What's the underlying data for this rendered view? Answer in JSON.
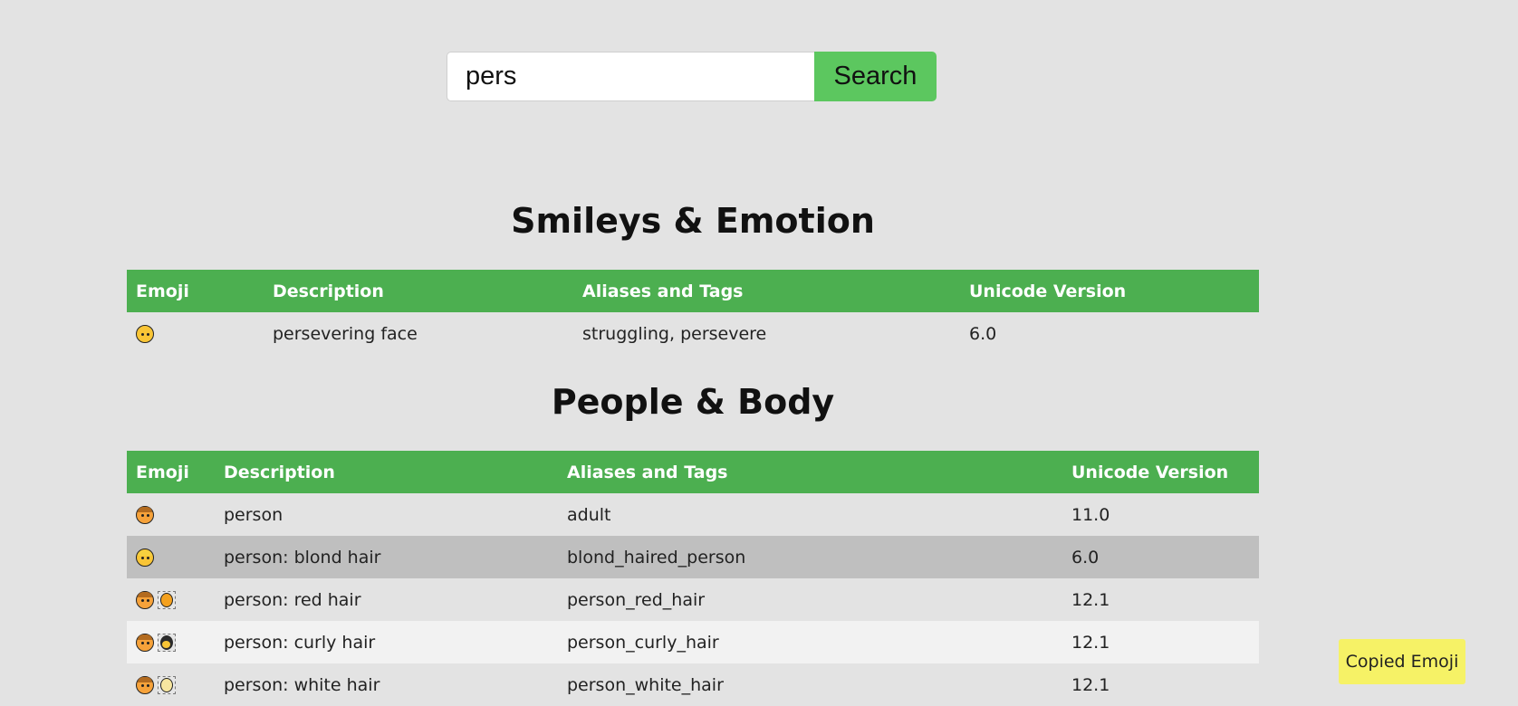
{
  "search": {
    "value": "pers",
    "button_label": "Search"
  },
  "sections": [
    {
      "title": "Smileys & Emotion",
      "headers": [
        "Emoji",
        "Description",
        "Aliases and Tags",
        "Unicode Version"
      ],
      "rows": [
        {
          "emoji": "😣",
          "description": "persevering face",
          "aliases": "struggling, persevere",
          "version": "6.0"
        }
      ]
    },
    {
      "title": "People & Body",
      "headers": [
        "Emoji",
        "Description",
        "Aliases and Tags",
        "Unicode Version"
      ],
      "rows": [
        {
          "emoji": "🧑",
          "description": "person",
          "aliases": "adult",
          "version": "11.0"
        },
        {
          "emoji": "👱",
          "description": "person: blond hair",
          "aliases": "blond_haired_person",
          "version": "6.0"
        },
        {
          "emoji": "🧑‍🦰",
          "description": "person: red hair",
          "aliases": "person_red_hair",
          "version": "12.1"
        },
        {
          "emoji": "🧑‍🦱",
          "description": "person: curly hair",
          "aliases": "person_curly_hair",
          "version": "12.1"
        },
        {
          "emoji": "🧑‍🦳",
          "description": "person: white hair",
          "aliases": "person_white_hair",
          "version": "12.1"
        }
      ]
    }
  ],
  "toast": {
    "text": "Copied Emoji"
  },
  "colors": {
    "background": "#e3e3e3",
    "header_green": "#4caf50",
    "button_green": "#5cc75f",
    "toast_yellow": "#f6f266",
    "hover_row": "#bfbfbf",
    "even_row": "#f2f2f2"
  }
}
